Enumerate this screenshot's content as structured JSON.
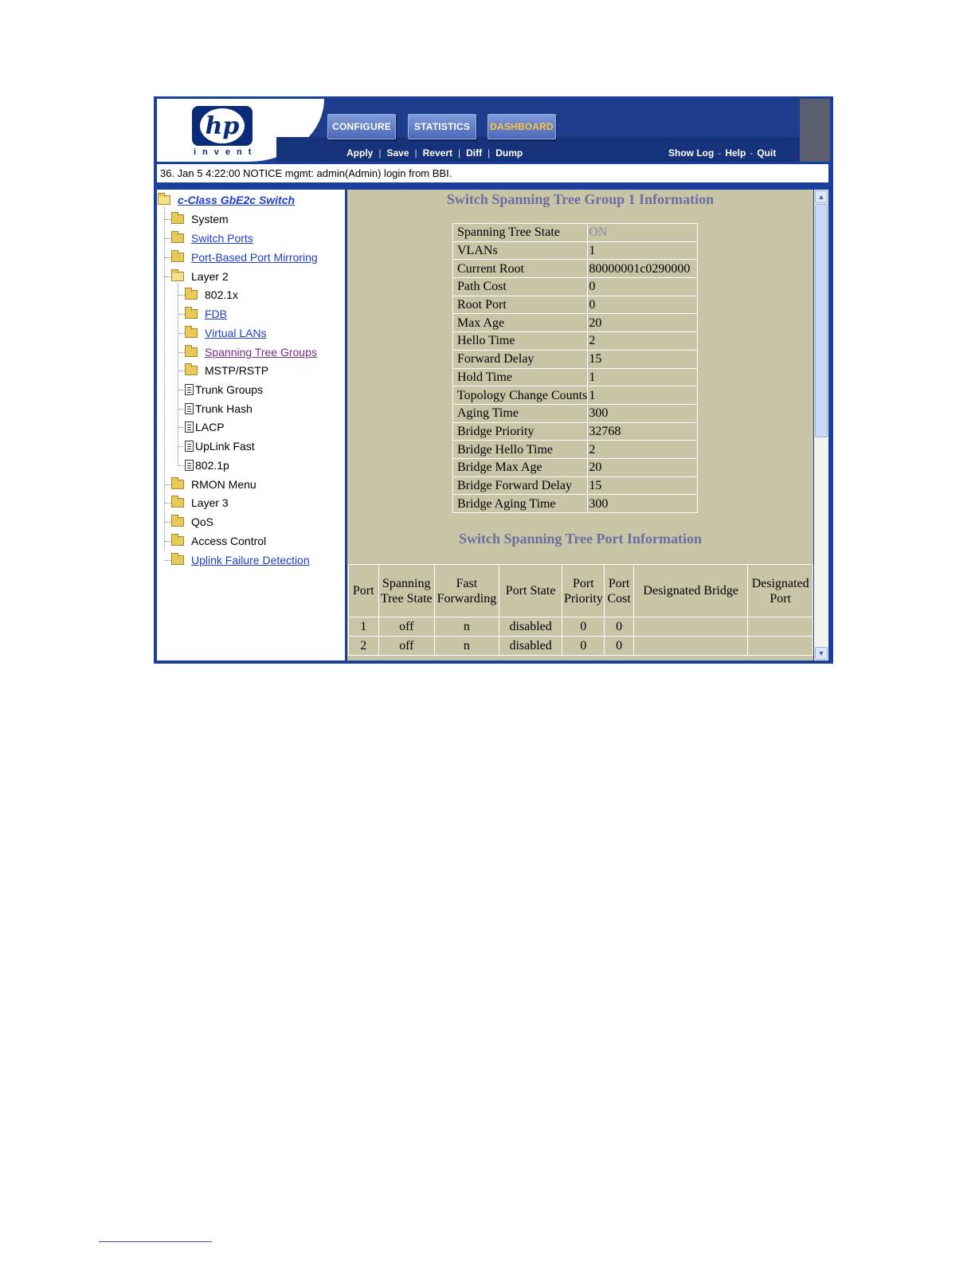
{
  "header": {
    "logo_text": "hp",
    "logo_tagline": "invent",
    "tabs": [
      {
        "label": "CONFIGURE"
      },
      {
        "label": "STATISTICS"
      },
      {
        "label": "DASHBOARD",
        "active": true
      }
    ],
    "actions": [
      "Apply",
      "Save",
      "Revert",
      "Diff",
      "Dump"
    ],
    "right_links": [
      "Show Log",
      "Help",
      "Quit"
    ]
  },
  "message": "36. Jan  5  4:22:00 NOTICE  mgmt: admin(Admin) login from BBI.",
  "nav": {
    "root": "c-Class GbE2c Switch",
    "items": [
      {
        "label": "System"
      },
      {
        "label": "Switch Ports"
      },
      {
        "label": "Port-Based Port Mirroring"
      },
      {
        "label": "Layer 2"
      },
      {
        "label": "802.1x"
      },
      {
        "label": "FDB"
      },
      {
        "label": "Virtual LANs"
      },
      {
        "label": "Spanning Tree Groups"
      },
      {
        "label": "MSTP/RSTP"
      },
      {
        "label": "Trunk Groups"
      },
      {
        "label": "Trunk Hash"
      },
      {
        "label": "LACP"
      },
      {
        "label": "UpLink Fast"
      },
      {
        "label": "802.1p"
      },
      {
        "label": "RMON Menu"
      },
      {
        "label": "Layer 3"
      },
      {
        "label": "QoS"
      },
      {
        "label": "Access Control"
      },
      {
        "label": "Uplink Failure Detection"
      }
    ]
  },
  "content": {
    "group_title": "Switch Spanning Tree Group 1 Information",
    "group_rows": [
      {
        "key": "Spanning Tree State",
        "value": "ON"
      },
      {
        "key": "VLANs",
        "value": "1"
      },
      {
        "key": "Current Root",
        "value": "80000001c0290000"
      },
      {
        "key": "Path Cost",
        "value": "0"
      },
      {
        "key": "Root Port",
        "value": "0"
      },
      {
        "key": "Max Age",
        "value": "20"
      },
      {
        "key": "Hello Time",
        "value": "2"
      },
      {
        "key": "Forward Delay",
        "value": "15"
      },
      {
        "key": "Hold Time",
        "value": "1"
      },
      {
        "key": "Topology Change Counts",
        "value": "1"
      },
      {
        "key": "Aging Time",
        "value": "300"
      },
      {
        "key": "Bridge Priority",
        "value": "32768"
      },
      {
        "key": "Bridge Hello Time",
        "value": "2"
      },
      {
        "key": "Bridge Max Age",
        "value": "20"
      },
      {
        "key": "Bridge Forward Delay",
        "value": "15"
      },
      {
        "key": "Bridge Aging Time",
        "value": "300"
      }
    ],
    "port_title": "Switch Spanning Tree Port Information",
    "port_columns": [
      "Port",
      "Spanning Tree State",
      "Fast Forwarding",
      "Port State",
      "Port Priority",
      "Port Cost",
      "Designated Bridge",
      "Designated Port"
    ],
    "port_rows": [
      [
        "1",
        "off",
        "n",
        "disabled",
        "0",
        "0",
        "",
        ""
      ],
      [
        "2",
        "off",
        "n",
        "disabled",
        "0",
        "0",
        "",
        ""
      ]
    ]
  }
}
